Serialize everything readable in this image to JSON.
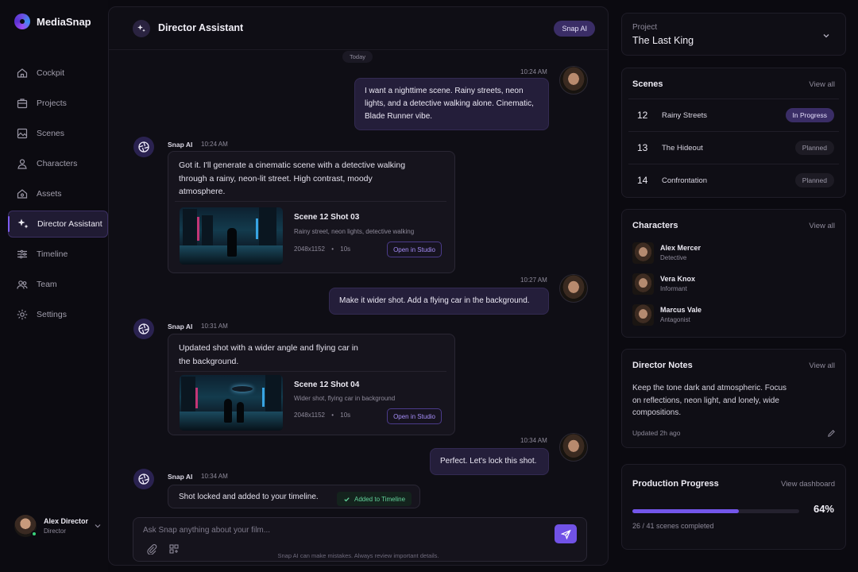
{
  "app": {
    "name": "MediaSnap"
  },
  "nav": [
    {
      "label": "Cockpit",
      "icon": "home-icon"
    },
    {
      "label": "Projects",
      "icon": "briefcase-icon"
    },
    {
      "label": "Scenes",
      "icon": "scenes-icon"
    },
    {
      "label": "Characters",
      "icon": "character-icon"
    },
    {
      "label": "Assets",
      "icon": "assets-icon"
    },
    {
      "label": "Director Assistant",
      "icon": "sparkle-icon",
      "active": true
    },
    {
      "label": "Timeline",
      "icon": "timeline-icon"
    },
    {
      "label": "Team",
      "icon": "team-icon"
    },
    {
      "label": "Settings",
      "icon": "gear-icon"
    }
  ],
  "user": {
    "name": "Alex Director",
    "role": "Director"
  },
  "chat": {
    "title": "Director Assistant",
    "badge": "Snap AI",
    "day_label": "Today",
    "messages": [
      {
        "from": "user",
        "time": "10:24 AM",
        "text": "I want a nighttime scene. Rainy streets, neon lights, and a detective walking alone. Cinematic, Blade Runner vibe."
      },
      {
        "from": "ai",
        "name": "Snap AI",
        "time": "10:24 AM",
        "text": "Got it. I'll generate a cinematic scene with a detective walking through a rainy, neon-lit street. High contrast, moody atmosphere.",
        "shot": {
          "title": "Scene 12 Shot 03",
          "desc": "Rainy street, neon lights, detective walking",
          "resolution": "2048x1152",
          "separator": "•",
          "duration": "10s",
          "button": "Open in Studio"
        }
      },
      {
        "from": "user",
        "time": "10:27 AM",
        "text": "Make it wider shot. Add a flying car in the background."
      },
      {
        "from": "ai",
        "name": "Snap AI",
        "time": "10:31 AM",
        "text": "Updated shot with a wider angle and flying car in the background.",
        "shot": {
          "title": "Scene 12 Shot 04",
          "desc": "Wider shot, flying car in background",
          "resolution": "2048x1152",
          "separator": "•",
          "duration": "10s",
          "button": "Open in Studio"
        }
      },
      {
        "from": "user",
        "time": "10:34 AM",
        "text": "Perfect. Let's lock this shot."
      },
      {
        "from": "ai",
        "name": "Snap AI",
        "time": "10:34 AM",
        "text": "Shot locked and added to your timeline.",
        "status": "Added to Timeline"
      }
    ],
    "composer": {
      "placeholder": "Ask Snap anything about your film...",
      "disclaimer": "Snap AI can make mistakes. Always review important details."
    }
  },
  "project": {
    "label": "Project",
    "name": "The Last King"
  },
  "scenes": {
    "title": "Scenes",
    "link": "View all",
    "items": [
      {
        "num": "12",
        "name": "Rainy Streets",
        "status": "In Progress",
        "color": "#3a2d66"
      },
      {
        "num": "13",
        "name": "The Hideout",
        "status": "Planned",
        "color": "#1d1b24"
      },
      {
        "num": "14",
        "name": "Confrontation",
        "status": "Planned",
        "color": "#1d1b24"
      }
    ]
  },
  "characters": {
    "title": "Characters",
    "link": "View all",
    "items": [
      {
        "name": "Alex Mercer",
        "role": "Detective"
      },
      {
        "name": "Vera Knox",
        "role": "Informant"
      },
      {
        "name": "Marcus Vale",
        "role": "Antagonist"
      }
    ]
  },
  "notes": {
    "title": "Director Notes",
    "link": "View all",
    "text": "Keep the tone dark and atmospheric. Focus on reflections, neon light, and lonely, wide compositions.",
    "updated": "Updated 2h ago"
  },
  "progress": {
    "title": "Production Progress",
    "link": "View dashboard",
    "percent_label": "64%",
    "fraction": 0.64,
    "subtitle": "26 / 41 scenes completed"
  },
  "colors": {
    "accent": "#7152e6",
    "success": "#63d39b",
    "background": "#0b0a10"
  }
}
